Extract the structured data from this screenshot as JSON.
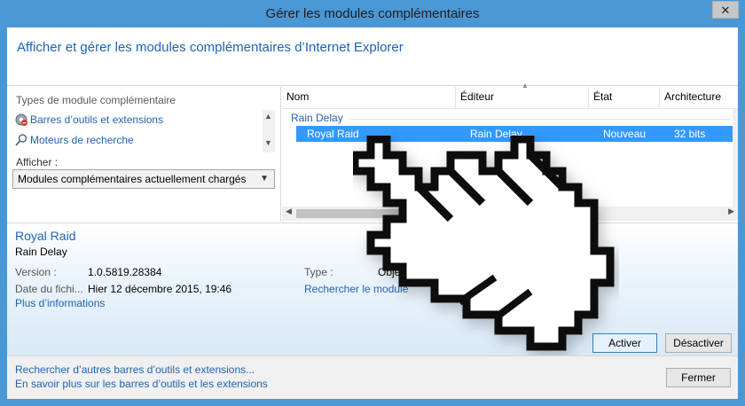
{
  "window": {
    "title": "Gérer les modules complémentaires",
    "close_glyph": "✕"
  },
  "header": {
    "title": "Afficher et gérer les modules complémentaires d’Internet Explorer"
  },
  "left_pane": {
    "types_label": "Types de module complémentaire",
    "types": [
      {
        "label": "Barres d’outils et extensions",
        "icon": "toolbar-gear-icon"
      },
      {
        "label": "Moteurs de recherche",
        "icon": "search-icon"
      }
    ],
    "show_label": "Afficher :",
    "show_value": "Modules complémentaires actuellement chargés"
  },
  "table": {
    "columns": [
      "Nom",
      "Éditeur",
      "État",
      "Architecture"
    ],
    "group": "Rain Delay",
    "rows": [
      {
        "name": "Royal Raid",
        "publisher": "Rain Delay",
        "status": "Nouveau",
        "architecture": "32 bits"
      }
    ]
  },
  "details": {
    "name": "Royal Raid",
    "publisher": "Rain Delay",
    "version_label": "Version :",
    "version_value": "1.0.5819.28384",
    "date_label": "Date du fichi...",
    "date_value": "Hier 12 décembre 2015, 19:46",
    "type_label": "Type :",
    "type_value": "Objet A",
    "search_module_link": "Rechercher le module",
    "more_info_link": "Plus d’informations",
    "enable_button": "Activer",
    "disable_button": "Désactiver"
  },
  "footer": {
    "link1": "Rechercher d’autres barres d’outils et extensions...",
    "link2": "En savoir plus sur les barres d’outils et les extensions",
    "close_button": "Fermer"
  },
  "colors": {
    "frame": "#4a97d6",
    "link": "#1e63b2",
    "selection": "#3399ff"
  }
}
